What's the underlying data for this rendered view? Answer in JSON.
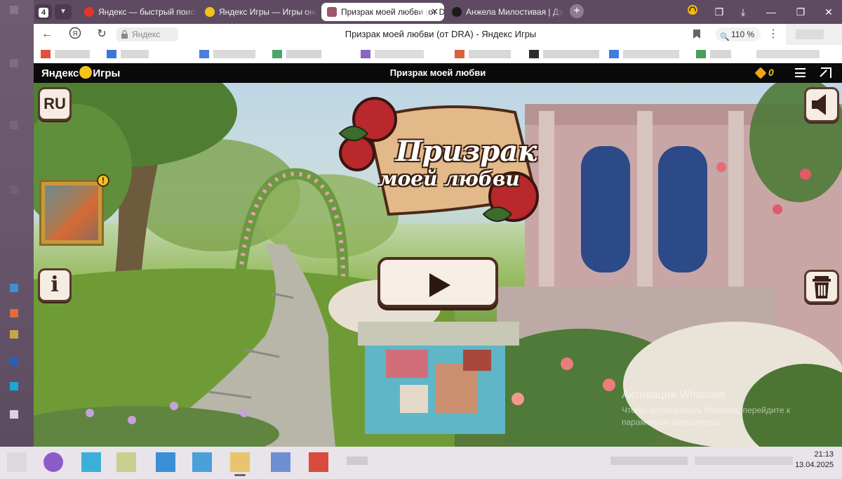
{
  "browser": {
    "tab_count": "4",
    "tabs": [
      {
        "label": "Яндекс — быстрый поиск",
        "icon": "yandex-icon",
        "active": false
      },
      {
        "label": "Яндекс Игры — Игры онлайн",
        "icon": "yandex-games-icon",
        "active": false
      },
      {
        "label": "Призрак моей любви (от DRA)",
        "icon": "game-favicon-icon",
        "active": true
      },
      {
        "label": "Анжела Милостивая | Дзен",
        "icon": "zen-icon",
        "active": false
      }
    ],
    "address": {
      "site_chip": "Яндекс",
      "page_title": "Призрак моей любви (от DRA) - Яндекс Игры",
      "zoom": "110 %"
    }
  },
  "game_header": {
    "logo_left": "Яндекс",
    "logo_right": "Игры",
    "title": "Призрак моей любви",
    "coins": "0"
  },
  "game": {
    "language_button": "RU",
    "info_button": "i",
    "alert_badge": "!",
    "logo_line1": "Призрак",
    "logo_line2": "моей любви"
  },
  "watermark": {
    "title": "Активация Windows",
    "subtitle": "Чтобы активировать Windows, перейдите к параметрам компьютера."
  },
  "taskbar": {
    "time": "21:13",
    "date": "13.04.2025"
  },
  "colors": {
    "tabbar": "#5e4b61",
    "game_header": "#0a0a0a",
    "button_border": "#5a3a2b",
    "coin": "#f4c21a"
  }
}
